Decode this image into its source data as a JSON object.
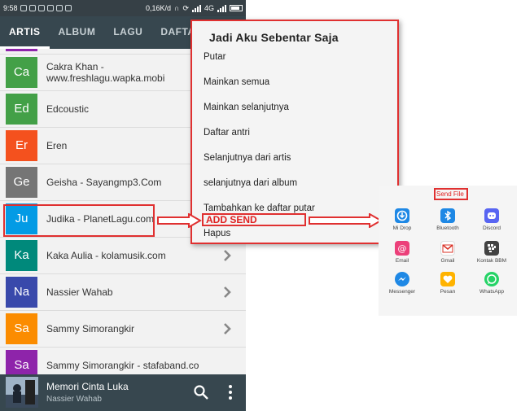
{
  "status_bar": {
    "time": "9:58",
    "speed": "0,16K/d",
    "network": "4G"
  },
  "tabs": [
    {
      "label": "ARTIS",
      "active": true
    },
    {
      "label": "ALBUM",
      "active": false
    },
    {
      "label": "LAGU",
      "active": false
    },
    {
      "label": "DAFTA",
      "active": false
    }
  ],
  "artists": [
    {
      "initials": "Ca",
      "line1": "Cakra Khan -",
      "line2": "www.freshlagu.wapka.mobi",
      "color": "#43a047"
    },
    {
      "initials": "Ed",
      "line1": "Edcoustic",
      "color": "#43a047"
    },
    {
      "initials": "Er",
      "line1": "Eren",
      "color": "#f4511e"
    },
    {
      "initials": "Ge",
      "line1": "Geisha - Sayangmp3.Com",
      "color": "#757575"
    },
    {
      "initials": "Ju",
      "line1": "Judika - PlanetLagu.com",
      "color": "#039be5"
    },
    {
      "initials": "Ka",
      "line1": "Kaka Aulia - kolamusik.com",
      "color": "#00897b"
    },
    {
      "initials": "Na",
      "line1": "Nassier Wahab",
      "color": "#3949ab"
    },
    {
      "initials": "Sa",
      "line1": "Sammy Simorangkir",
      "color": "#fb8c00"
    },
    {
      "initials": "Sa",
      "line1": "Sammy Simorangkir - stafaband.co",
      "color": "#8e24aa"
    }
  ],
  "player": {
    "title": "Memori Cinta Luka",
    "artist": "Nassier Wahab"
  },
  "menu": {
    "title": "Jadi Aku Sebentar Saja",
    "items": [
      "Putar",
      "Mainkan semua",
      "Mainkan selanjutnya",
      "Daftar antri",
      "Selanjutnya dari artis",
      "selanjutnya dari album",
      "Tambahkan ke daftar putar",
      "Hapus"
    ],
    "annotation": "ADD SEND"
  },
  "share": {
    "title": "Send File",
    "apps": [
      {
        "label": "Mi Drop",
        "color": "#1e88e5",
        "icon": "mi-drop-icon"
      },
      {
        "label": "Bluetooth",
        "color": "#1e88e5",
        "icon": "bluetooth-icon"
      },
      {
        "label": "Discord",
        "color": "#5865f2",
        "icon": "discord-icon"
      },
      {
        "label": "Email",
        "color": "#ec407a",
        "icon": "email-icon"
      },
      {
        "label": "Gmail",
        "color": "#ffffff",
        "icon": "gmail-icon"
      },
      {
        "label": "Kontak BBM",
        "color": "#424242",
        "icon": "bbm-icon"
      },
      {
        "label": "Messenger",
        "color": "#1e88e5",
        "icon": "messenger-icon"
      },
      {
        "label": "Pesan",
        "color": "#ffb300",
        "icon": "message-icon"
      },
      {
        "label": "WhatsApp",
        "color": "#25d366",
        "icon": "whatsapp-icon"
      }
    ]
  }
}
